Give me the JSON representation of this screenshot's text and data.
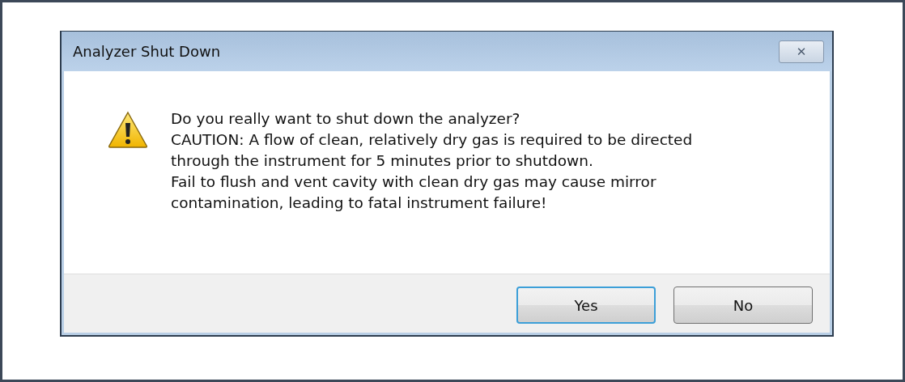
{
  "window": {
    "title": "Analyzer Shut Down",
    "close_label": "✕"
  },
  "message": {
    "kind": "warning",
    "lines": [
      "Do you really want to shut down the analyzer?",
      "CAUTION: A flow of clean, relatively dry gas is required to be directed",
      "through the instrument for 5 minutes prior to shutdown.",
      "Fail to flush and vent cavity with clean dry gas may cause mirror",
      "contamination, leading to fatal instrument failure!"
    ]
  },
  "buttons": [
    {
      "label": "Yes",
      "focused": true
    },
    {
      "label": "No",
      "focused": false
    }
  ]
}
